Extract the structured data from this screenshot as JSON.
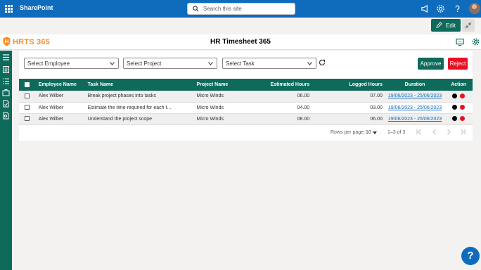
{
  "suite": {
    "app_name": "SharePoint"
  },
  "search": {
    "placeholder": "Search this site"
  },
  "toolbar": {
    "edit_label": "Edit"
  },
  "header": {
    "logo_text": "HRTS 365",
    "title": "HR Timesheet 365"
  },
  "filters": {
    "employee": "Select Employee",
    "project": "Select Project",
    "task": "Select Task"
  },
  "actions": {
    "approve": "Approve",
    "reject": "Reject"
  },
  "table": {
    "columns": [
      "Employee Name",
      "Task Name",
      "Project Name",
      "Estimated Hours",
      "Logged Hours",
      "Duration",
      "Action"
    ],
    "rows": [
      {
        "employee": "Alex Wilber",
        "task": "Break project phases into tasks",
        "project": "Micro Winds",
        "estimated": "06.00",
        "logged": "07.00",
        "duration": "19/06/2023 - 25/06/2023"
      },
      {
        "employee": "Alex Wilber",
        "task": "Estimate the time required for each t...",
        "project": "Micro Winds",
        "estimated": "04.00",
        "logged": "03.00",
        "duration": "19/06/2023 - 25/06/2023"
      },
      {
        "employee": "Alex Wilber",
        "task": "Understand the project scope",
        "project": "Micro Winds",
        "estimated": "08.00",
        "logged": "06.00",
        "duration": "19/06/2023 - 25/06/2023"
      }
    ]
  },
  "pagination": {
    "rows_label": "Rows per page:",
    "rows_value": "10",
    "range": "1–3 of 3"
  },
  "help": {
    "label": "?"
  },
  "colors": {
    "suite_bar": "#0f6cbd",
    "brand": "#0e6a5a",
    "reject": "#e81123",
    "logo": "#ff8a1f"
  }
}
